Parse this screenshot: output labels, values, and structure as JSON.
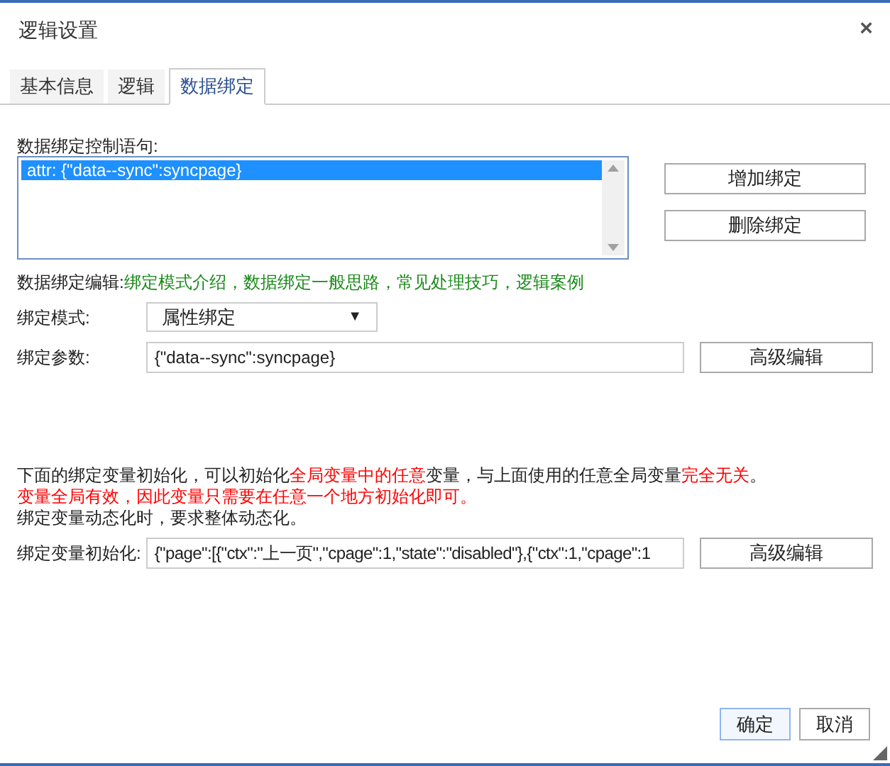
{
  "window": {
    "title": "逻辑设置",
    "close": "×"
  },
  "tabs": [
    {
      "label": "基本信息",
      "selected": false
    },
    {
      "label": "逻辑",
      "selected": false
    },
    {
      "label": "数据绑定",
      "selected": true
    }
  ],
  "statements": {
    "label": "数据绑定控制语句:",
    "items": [
      {
        "text": "attr: {\"data--sync\":syncpage}",
        "selected": true
      }
    ],
    "buttons": [
      "增加绑定",
      "删除绑定"
    ]
  },
  "editor": {
    "label": "数据绑定编辑:",
    "links": [
      {
        "text": "绑定模式介绍",
        "after": "，"
      },
      {
        "text": "数据绑定一般思路",
        "after": "，"
      },
      {
        "text": "常见处理技巧",
        "after": "，"
      },
      {
        "text": "逻辑案例"
      }
    ]
  },
  "mode": {
    "label": "绑定模式:",
    "value": "属性绑定",
    "arrow": "▼"
  },
  "params": {
    "label": "绑定参数:",
    "value": "{\"data--sync\":syncpage}",
    "button": "高级编辑"
  },
  "notes": [
    {
      "parts": [
        {
          "text": "下面的绑定变量初始化，可以初始化",
          "kind": "normal"
        },
        {
          "text": "全局变量中的任意",
          "kind": "red"
        },
        {
          "text": "变量，与上面使用的任意全局变量",
          "kind": "normal"
        },
        {
          "text": "完全无关",
          "kind": "red"
        },
        {
          "text": "。",
          "kind": "normal"
        }
      ]
    },
    {
      "parts": [
        {
          "text": "变量全局有效，因此变量只需要在任意一个地方初始化即可。",
          "kind": "red"
        }
      ]
    },
    {
      "parts": [
        {
          "text": "绑定变量动态化时，要求整体动态化。",
          "kind": "normal"
        }
      ]
    }
  ],
  "init": {
    "label": "绑定变量初始化:",
    "value": "{\"page\":[{\"ctx\":\"上一页\",\"cpage\":1,\"state\":\"disabled\"},{\"ctx\":1,\"cpage\":1",
    "button": "高级编辑"
  },
  "footer": {
    "buttons": [
      {
        "label": "确定",
        "kind": "primary"
      },
      {
        "label": "取消",
        "kind": "normal"
      }
    ]
  }
}
